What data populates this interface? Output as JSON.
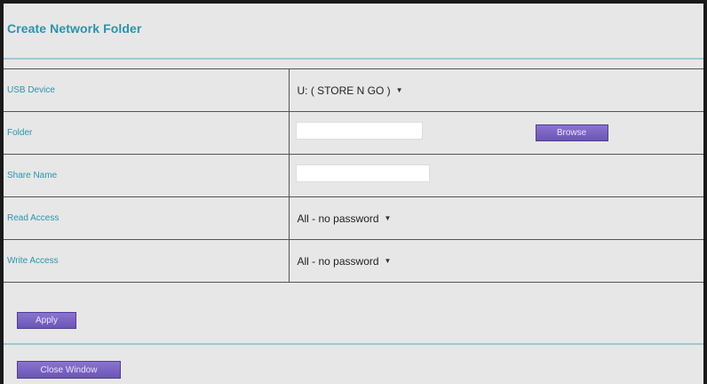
{
  "dialog": {
    "title": "Create Network Folder"
  },
  "form": {
    "rows": [
      {
        "label": "USB Device",
        "type": "select",
        "value": "U: ( STORE N GO )"
      },
      {
        "label": "Folder",
        "type": "text",
        "value": "",
        "button": "Browse"
      },
      {
        "label": "Share Name",
        "type": "text",
        "value": ""
      },
      {
        "label": "Read Access",
        "type": "select",
        "value": "All - no password"
      },
      {
        "label": "Write Access",
        "type": "select",
        "value": "All - no password"
      }
    ]
  },
  "buttons": {
    "apply": "Apply",
    "close": "Close Window"
  },
  "colors": {
    "accent": "#2a93ad",
    "button": "#7a63c2",
    "background": "#e7e7e7"
  }
}
